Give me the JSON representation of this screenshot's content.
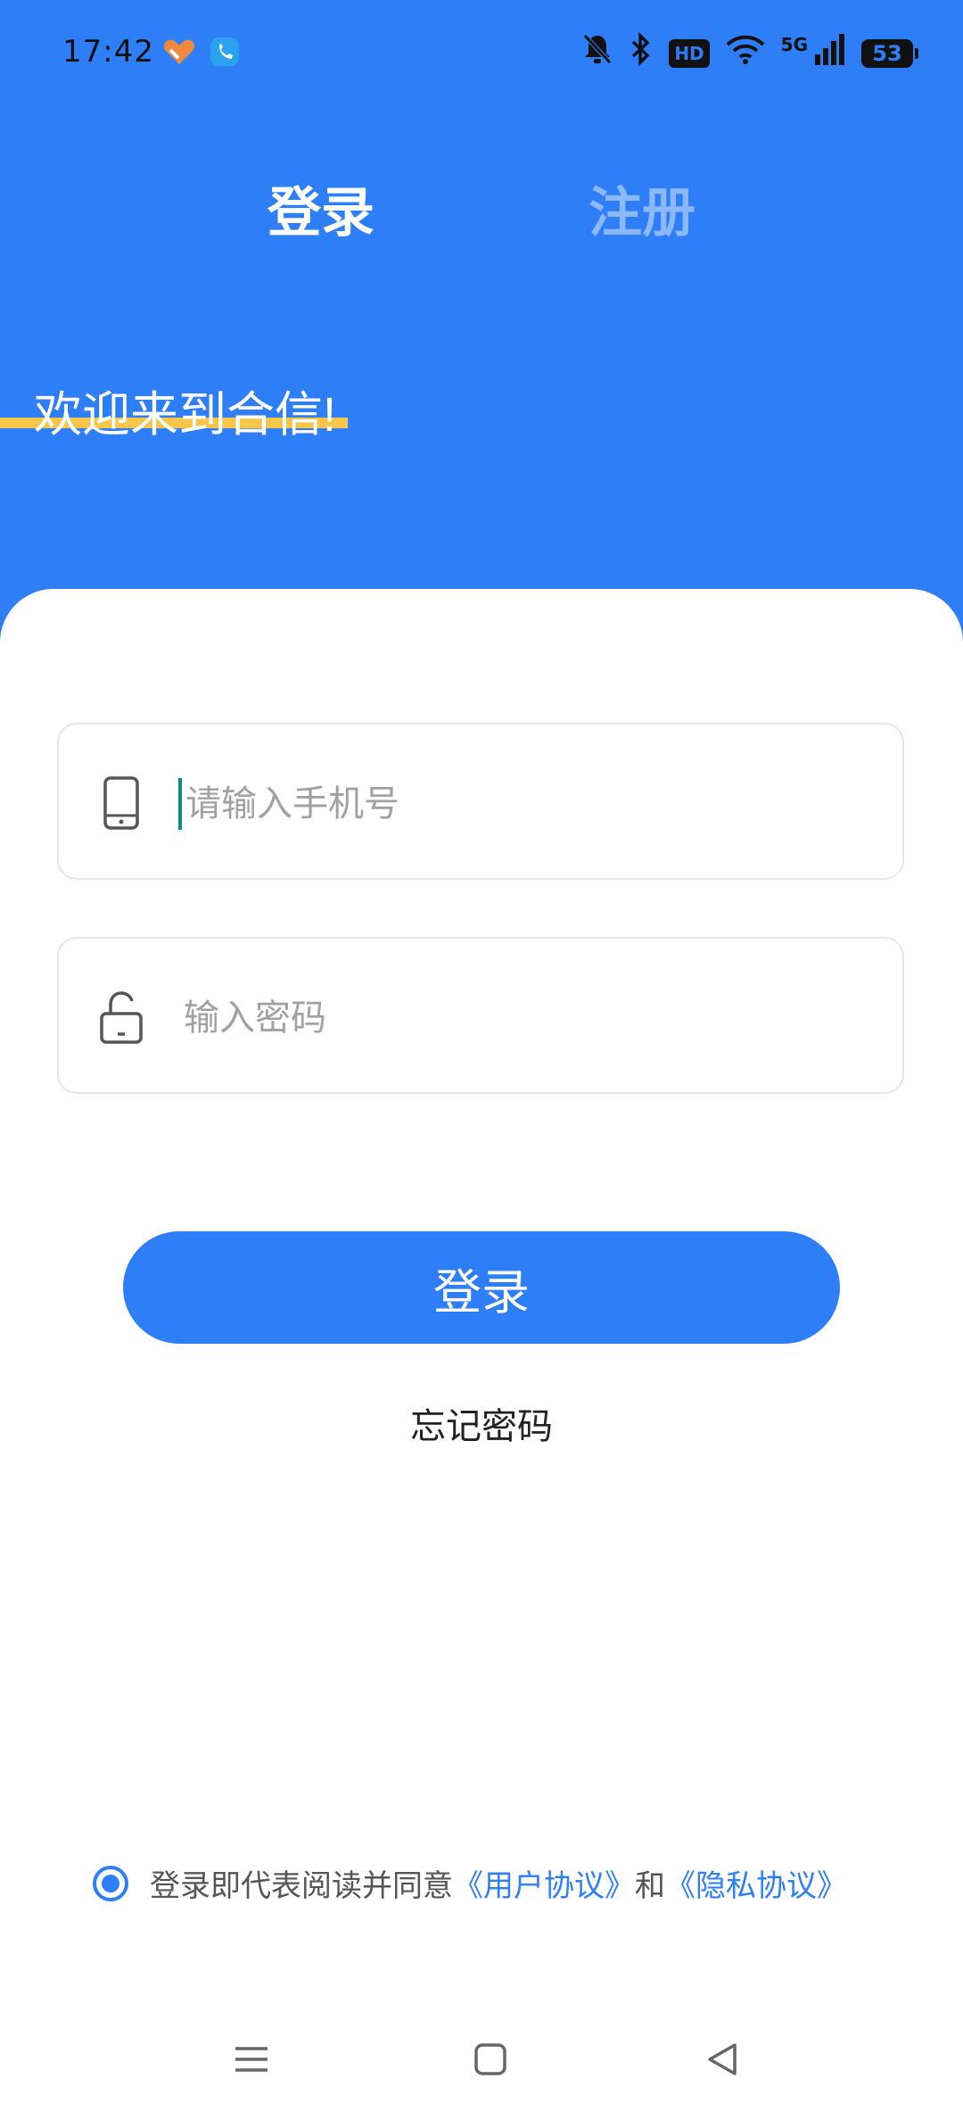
{
  "status_bar": {
    "time": "17:42",
    "network": "5G",
    "hd": "HD",
    "battery": "53",
    "icons": [
      "app-heart-icon",
      "call-icon",
      "mute-bell-icon",
      "bluetooth-icon",
      "hd-icon",
      "wifi-icon",
      "signal-icon",
      "battery-icon"
    ]
  },
  "tabs": {
    "login": "登录",
    "register": "注册"
  },
  "welcome": "欢迎来到合信!",
  "form": {
    "phone_placeholder": "请输入手机号",
    "phone_value": "",
    "password_placeholder": "输入密码",
    "password_value": ""
  },
  "login_button": "登录",
  "forgot_password": "忘记密码",
  "agreement": {
    "prefix": "登录即代表阅读并同意",
    "user_agreement": "《用户协议》",
    "and": "和",
    "privacy_agreement": "《隐私协议》",
    "checked": true
  },
  "nav_icons": [
    "menu-icon",
    "home-icon",
    "back-icon"
  ],
  "colors": {
    "primary": "#2d7ef7",
    "accent_bar": "#f6c64a",
    "inactive_tab": "#8ab8fb"
  }
}
